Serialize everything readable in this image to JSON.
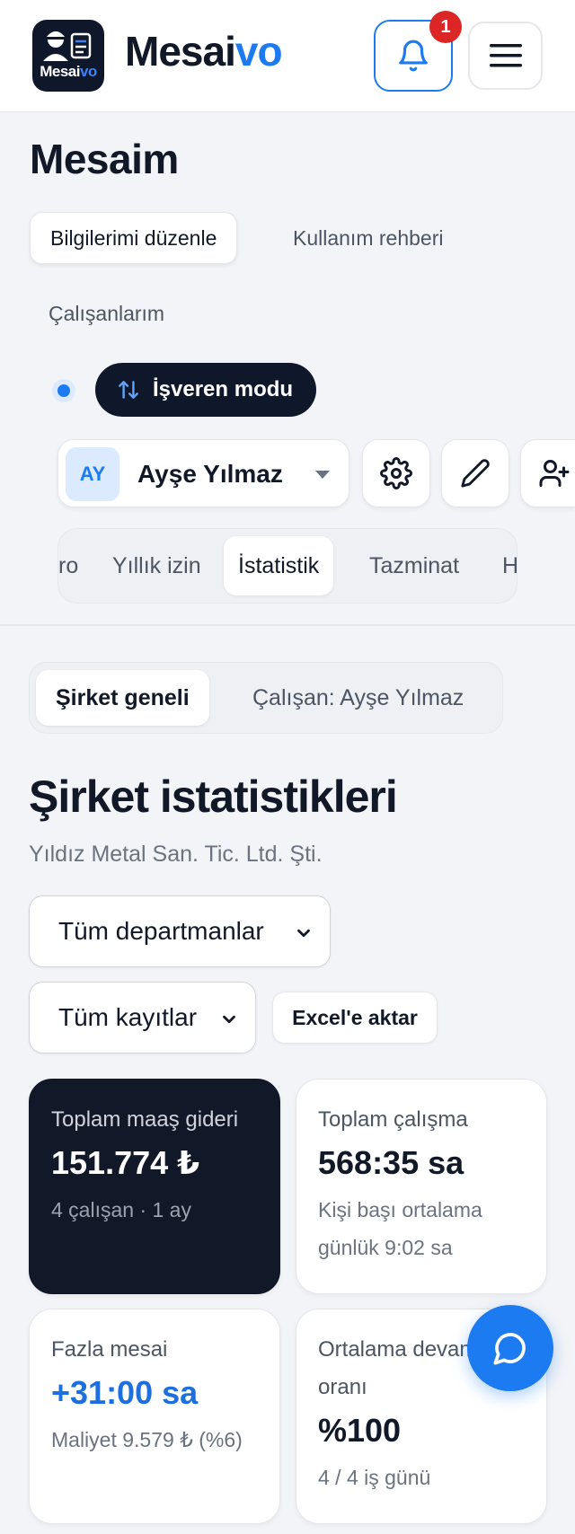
{
  "header": {
    "brand_main": "Mesai",
    "brand_accent": "vo",
    "logo_main": "Mesai",
    "logo_accent": "vo",
    "notification_count": "1"
  },
  "page": {
    "title": "Mesaim"
  },
  "nav_links": [
    {
      "label": "Bilgilerimi düzenle",
      "active": true
    },
    {
      "label": "Kullanım rehberi",
      "active": false
    },
    {
      "label": "Çalışanlarım",
      "active": false
    }
  ],
  "mode": {
    "label": "İşveren modu"
  },
  "employee": {
    "initials": "AY",
    "name": "Ayşe Yılmaz"
  },
  "sub_tabs": [
    {
      "label": "ro",
      "active": false
    },
    {
      "label": "Yıllık izin",
      "active": false
    },
    {
      "label": "İstatistik",
      "active": true
    },
    {
      "label": "Tazminat",
      "active": false
    },
    {
      "label": "H",
      "active": false
    }
  ],
  "scope": [
    {
      "label": "Şirket geneli",
      "active": true
    },
    {
      "label": "Çalışan: Ayşe Yılmaz",
      "active": false
    }
  ],
  "stats": {
    "title": "Şirket istatistikleri",
    "company": "Yıldız Metal San. Tic. Ltd. Şti."
  },
  "filters": {
    "department": "Tüm departmanlar",
    "records": "Tüm kayıtlar",
    "export_label": "Excel'e aktar"
  },
  "cards": [
    {
      "label": "Toplam maaş gideri",
      "value": "151.774 ₺",
      "note": "4 çalışan · 1 ay"
    },
    {
      "label": "Toplam çalışma",
      "value": "568:35 sa",
      "note": "Kişi başı ortalama günlük 9:02 sa"
    },
    {
      "label": "Fazla mesai",
      "value": "+31:00 sa",
      "note": "Maliyet 9.579 ₺ (%6)"
    },
    {
      "label": "Ortalama devam oranı",
      "value": "%100",
      "note": "4 / 4 iş günü"
    }
  ],
  "colors": {
    "accent": "#1d7bf2",
    "dark": "#111827",
    "badge": "#dc2626"
  }
}
